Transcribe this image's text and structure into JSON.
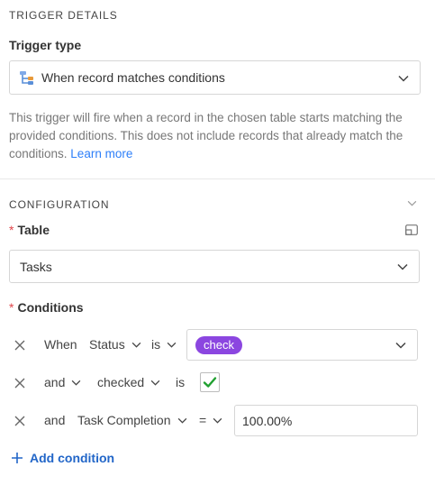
{
  "trigger_details": {
    "section_title": "TRIGGER DETAILS",
    "trigger_type_label": "Trigger type",
    "trigger_type_value": "When record matches conditions",
    "description": "This trigger will fire when a record in the chosen table starts matching the provided conditions. This does not include records that already match the conditions.",
    "learn_more": "Learn more"
  },
  "configuration": {
    "section_title": "CONFIGURATION",
    "table_label": "Table",
    "table_value": "Tasks",
    "conditions_label": "Conditions",
    "required_mark": "*",
    "conditions": [
      {
        "connector": "When",
        "field": "Status",
        "operator": "is",
        "value": "check"
      },
      {
        "connector": "and",
        "field": "checked",
        "operator": "is",
        "value_checked": true
      },
      {
        "connector": "and",
        "field": "Task Completion",
        "operator": "=",
        "value": "100.00%"
      }
    ],
    "add_condition": "Add condition"
  },
  "colors": {
    "pill_bg": "#8b46e0",
    "link": "#2d7ff9",
    "add_condition": "#2266c8",
    "required": "#e0454a",
    "check": "#20a030"
  }
}
